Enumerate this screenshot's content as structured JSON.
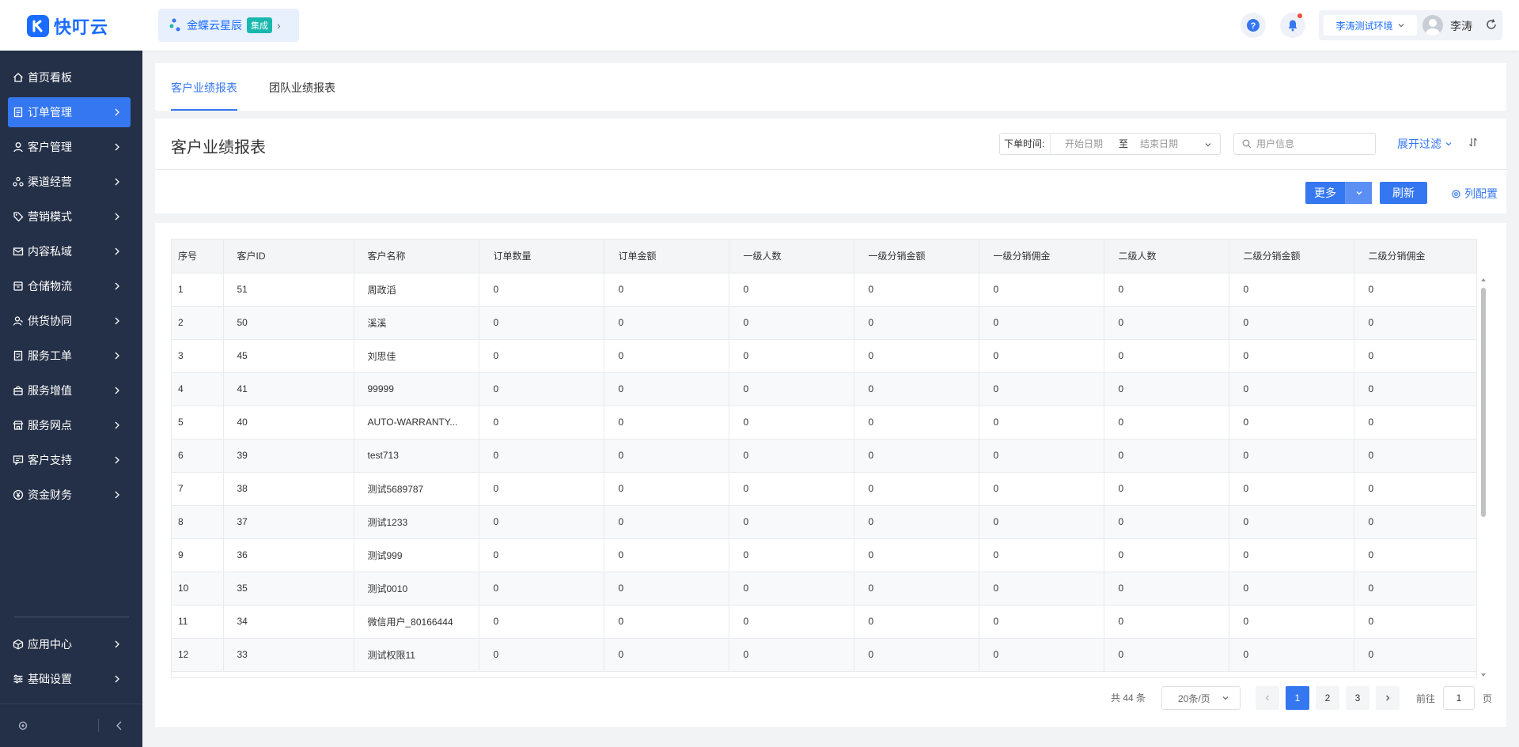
{
  "app": {
    "logo_text": "快叮云"
  },
  "integration": {
    "name": "金蝶云星辰",
    "badge": "集成"
  },
  "header": {
    "env_label": "李涛测试环境",
    "user_name": "李涛"
  },
  "sidebar": {
    "items": [
      {
        "label": "首页看板",
        "icon": "home-icon"
      },
      {
        "label": "订单管理",
        "icon": "document-icon"
      },
      {
        "label": "客户管理",
        "icon": "user-icon"
      },
      {
        "label": "渠道经营",
        "icon": "channel-icon"
      },
      {
        "label": "营销模式",
        "icon": "tag-icon"
      },
      {
        "label": "内容私域",
        "icon": "mail-icon"
      },
      {
        "label": "仓储物流",
        "icon": "box-icon"
      },
      {
        "label": "供货协同",
        "icon": "supply-icon"
      },
      {
        "label": "服务工单",
        "icon": "ticket-icon"
      },
      {
        "label": "服务增值",
        "icon": "bag-icon"
      },
      {
        "label": "服务网点",
        "icon": "store-icon"
      },
      {
        "label": "客户支持",
        "icon": "support-icon"
      },
      {
        "label": "资金财务",
        "icon": "yuan-icon"
      }
    ],
    "bottom_items": [
      {
        "label": "应用中心",
        "icon": "cube-icon"
      },
      {
        "label": "基础设置",
        "icon": "settings-icon"
      }
    ]
  },
  "tabs": [
    {
      "label": "客户业绩报表"
    },
    {
      "label": "团队业绩报表"
    }
  ],
  "page": {
    "title": "客户业绩报表"
  },
  "filters": {
    "date_label": "下单时间:",
    "date_start_placeholder": "开始日期",
    "date_to": "至",
    "date_end_placeholder": "结束日期",
    "search_placeholder": "用户信息",
    "expand_label": "展开过滤"
  },
  "toolbar": {
    "more_label": "更多",
    "refresh_label": "刷新",
    "column_config_label": "列配置"
  },
  "table": {
    "columns": [
      "序号",
      "客户ID",
      "客户名称",
      "订单数量",
      "订单金额",
      "一级人数",
      "一级分销金额",
      "一级分销佣金",
      "二级人数",
      "二级分销金额",
      "二级分销佣金"
    ],
    "rows": [
      [
        "1",
        "51",
        "周政滔",
        "0",
        "0",
        "0",
        "0",
        "0",
        "0",
        "0",
        "0"
      ],
      [
        "2",
        "50",
        "溪溪",
        "0",
        "0",
        "0",
        "0",
        "0",
        "0",
        "0",
        "0"
      ],
      [
        "3",
        "45",
        "刘思佳",
        "0",
        "0",
        "0",
        "0",
        "0",
        "0",
        "0",
        "0"
      ],
      [
        "4",
        "41",
        "99999",
        "0",
        "0",
        "0",
        "0",
        "0",
        "0",
        "0",
        "0"
      ],
      [
        "5",
        "40",
        "AUTO-WARRANTY...",
        "0",
        "0",
        "0",
        "0",
        "0",
        "0",
        "0",
        "0"
      ],
      [
        "6",
        "39",
        "test713",
        "0",
        "0",
        "0",
        "0",
        "0",
        "0",
        "0",
        "0"
      ],
      [
        "7",
        "38",
        "测试5689787",
        "0",
        "0",
        "0",
        "0",
        "0",
        "0",
        "0",
        "0"
      ],
      [
        "8",
        "37",
        "测试1233",
        "0",
        "0",
        "0",
        "0",
        "0",
        "0",
        "0",
        "0"
      ],
      [
        "9",
        "36",
        "测试999",
        "0",
        "0",
        "0",
        "0",
        "0",
        "0",
        "0",
        "0"
      ],
      [
        "10",
        "35",
        "测试0010",
        "0",
        "0",
        "0",
        "0",
        "0",
        "0",
        "0",
        "0"
      ],
      [
        "11",
        "34",
        "微信用户_80166444",
        "0",
        "0",
        "0",
        "0",
        "0",
        "0",
        "0",
        "0"
      ],
      [
        "12",
        "33",
        "测试权限11",
        "0",
        "0",
        "0",
        "0",
        "0",
        "0",
        "0",
        "0"
      ]
    ]
  },
  "pagination": {
    "total_label": "共 44 条",
    "page_size_label": "20条/页",
    "pages": [
      "1",
      "2",
      "3"
    ],
    "current_page": "1",
    "goto_label": "前往",
    "goto_value": "1",
    "goto_suffix": "页"
  },
  "colors": {
    "accent": "#3577f0",
    "sidebar_bg": "#243047",
    "brand": "#1a6cff"
  }
}
